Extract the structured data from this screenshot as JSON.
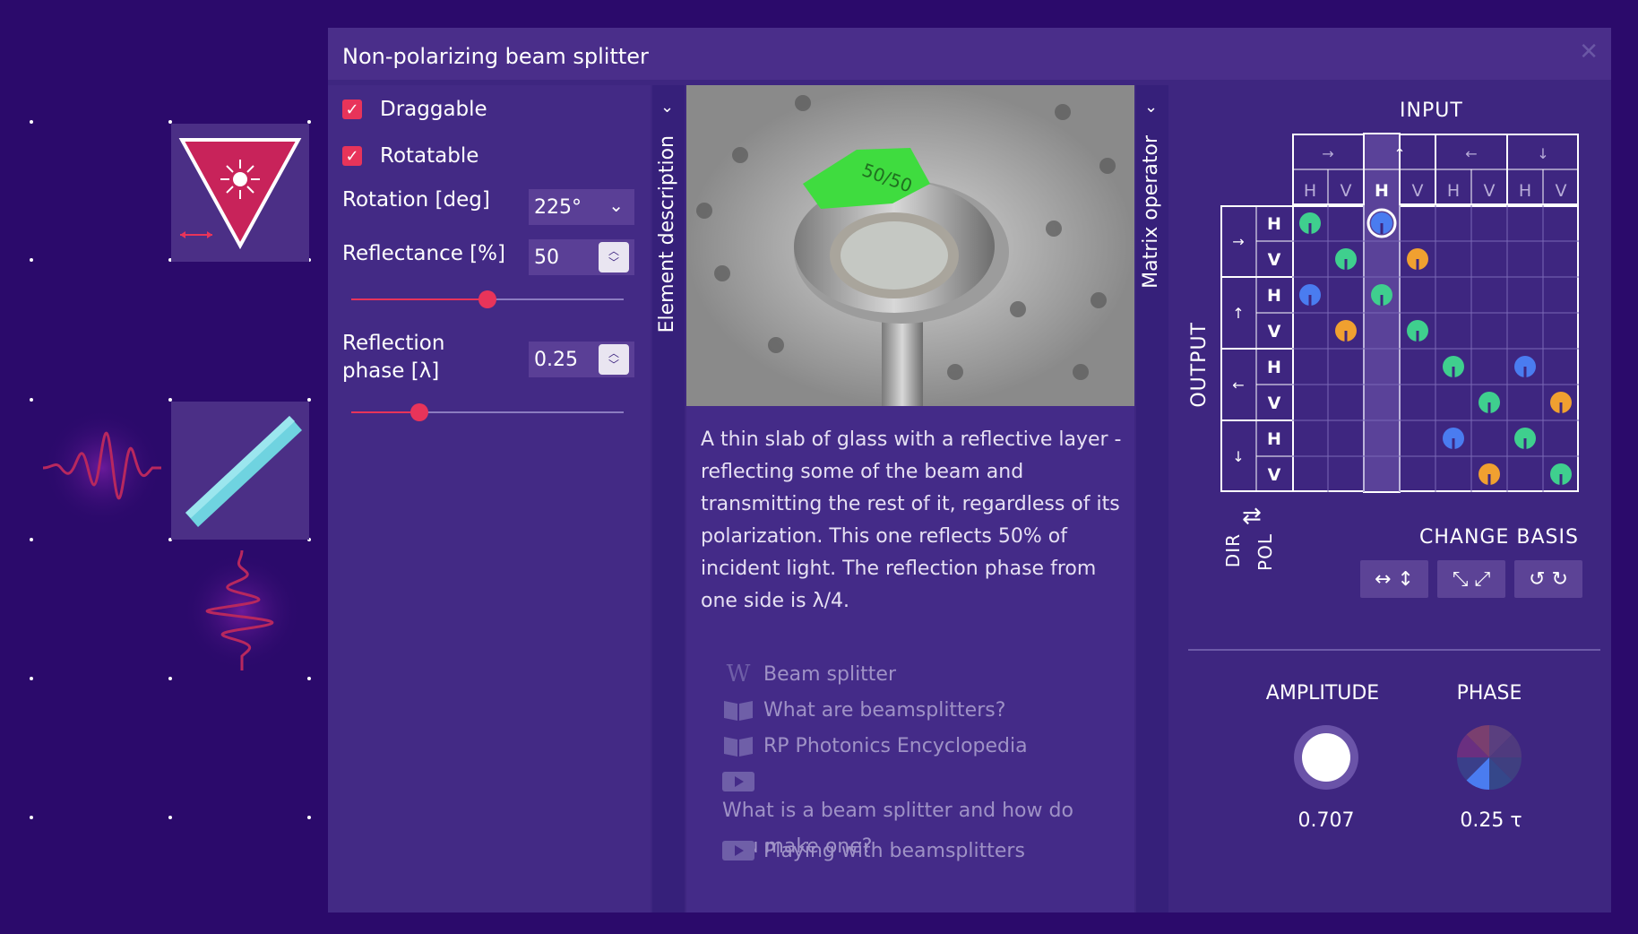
{
  "window": {
    "title": "Non-polarizing beam splitter",
    "close_icon": "close-icon"
  },
  "settings": {
    "draggable_label": "Draggable",
    "rotatable_label": "Rotatable",
    "rotation_label": "Rotation [deg]",
    "rotation_value": "225°",
    "reflectance_label": "Reflectance [%]",
    "reflectance_value": "50",
    "reflectance_fraction": 0.5,
    "phase_label_line1": "Reflection",
    "phase_label_line2": "phase [λ]",
    "phase_value": "0.25",
    "phase_fraction": 0.25
  },
  "tabs": {
    "element_description": "Element description",
    "matrix_operator": "Matrix operator"
  },
  "description": {
    "text": "A thin slab of glass with a reflective layer - reflecting some of the beam and transmitting the rest of it, regardless of its polarization. This one reflects 50% of incident light. The reflection phase from one side is λ/4.",
    "photo_label": "50/50",
    "links": [
      {
        "icon": "wikipedia-icon",
        "label": "Beam splitter"
      },
      {
        "icon": "book-icon",
        "label": "What are beamsplitters?"
      },
      {
        "icon": "book-icon",
        "label": "RP Photonics Encyclopedia"
      },
      {
        "icon": "video-icon",
        "label": "What is a beam splitter and how do you make one?"
      },
      {
        "icon": "video-icon",
        "label": "Playing with beamsplitters"
      }
    ]
  },
  "matrix": {
    "input_label": "INPUT",
    "output_label": "OUTPUT",
    "directions": [
      "→",
      "↑",
      "←",
      "↓"
    ],
    "polarizations": [
      "H",
      "V",
      "H",
      "V",
      "H",
      "V",
      "H",
      "V"
    ],
    "highlighted_column": 2,
    "entries": [
      {
        "row": 0,
        "col": 0,
        "phase_color": "#3fcf8e"
      },
      {
        "row": 0,
        "col": 2,
        "phase_color": "#4a7cf0",
        "selected": true
      },
      {
        "row": 1,
        "col": 1,
        "phase_color": "#3fcf8e"
      },
      {
        "row": 1,
        "col": 3,
        "phase_color": "#f0a030"
      },
      {
        "row": 2,
        "col": 0,
        "phase_color": "#4a7cf0"
      },
      {
        "row": 2,
        "col": 2,
        "phase_color": "#3fcf8e"
      },
      {
        "row": 3,
        "col": 1,
        "phase_color": "#f0a030"
      },
      {
        "row": 3,
        "col": 3,
        "phase_color": "#3fcf8e"
      },
      {
        "row": 4,
        "col": 4,
        "phase_color": "#3fcf8e"
      },
      {
        "row": 4,
        "col": 6,
        "phase_color": "#4a7cf0"
      },
      {
        "row": 5,
        "col": 5,
        "phase_color": "#3fcf8e"
      },
      {
        "row": 5,
        "col": 7,
        "phase_color": "#f0a030"
      },
      {
        "row": 6,
        "col": 4,
        "phase_color": "#4a7cf0"
      },
      {
        "row": 6,
        "col": 6,
        "phase_color": "#3fcf8e"
      },
      {
        "row": 7,
        "col": 5,
        "phase_color": "#f0a030"
      },
      {
        "row": 7,
        "col": 7,
        "phase_color": "#3fcf8e"
      }
    ],
    "dir_label": "DIR",
    "pol_label": "POL",
    "swap_icon": "swap-arrows-icon",
    "change_basis_label": "CHANGE BASIS",
    "basis_buttons": [
      {
        "icon": "horizontal-vertical-arrows-icon",
        "glyph": "↔ ↕"
      },
      {
        "icon": "diagonal-arrows-icon",
        "glyph": "⤡ ⤢"
      },
      {
        "icon": "circular-arrows-icon",
        "glyph": "↺ ↻"
      }
    ],
    "amplitude_label": "AMPLITUDE",
    "amplitude_value": "0.707",
    "phase_label": "PHASE",
    "phase_value": "0.25 τ"
  },
  "colors": {
    "background": "#2b0a6b",
    "panel": "#3e2680",
    "accent": "#e8345a",
    "green": "#3fcf8e",
    "blue": "#4a7cf0",
    "orange": "#f0a030"
  }
}
